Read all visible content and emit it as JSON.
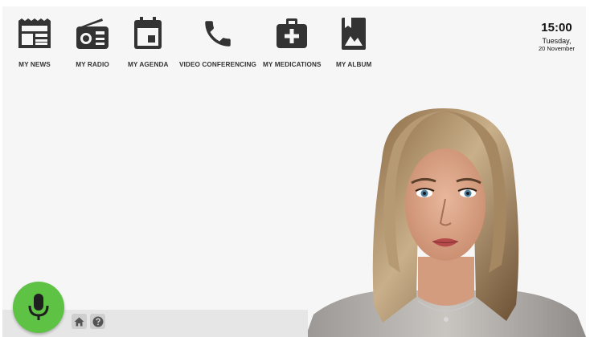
{
  "apps": [
    {
      "label": "MY NEWS",
      "icon": "newspaper-icon"
    },
    {
      "label": "MY RADIO",
      "icon": "radio-icon"
    },
    {
      "label": "MY AGENDA",
      "icon": "calendar-icon"
    },
    {
      "label": "VIDEO CONFERENCING",
      "icon": "phone-icon"
    },
    {
      "label": "MY MEDICATIONS",
      "icon": "medical-kit-icon"
    },
    {
      "label": "MY ALBUM",
      "icon": "photo-album-icon"
    }
  ],
  "clock": {
    "time": "15:00",
    "day": "Tuesday,",
    "date": "20 November"
  },
  "assistant": {
    "avatar": "virtual-assistant-avatar"
  },
  "controls": {
    "mic_icon": "microphone-icon",
    "home_icon": "home-icon",
    "help_icon": "help-icon"
  },
  "colors": {
    "mic": "#5ec245",
    "icons": "#333333",
    "background": "#f6f6f6",
    "bottom_bar": "#e6e6e6"
  }
}
